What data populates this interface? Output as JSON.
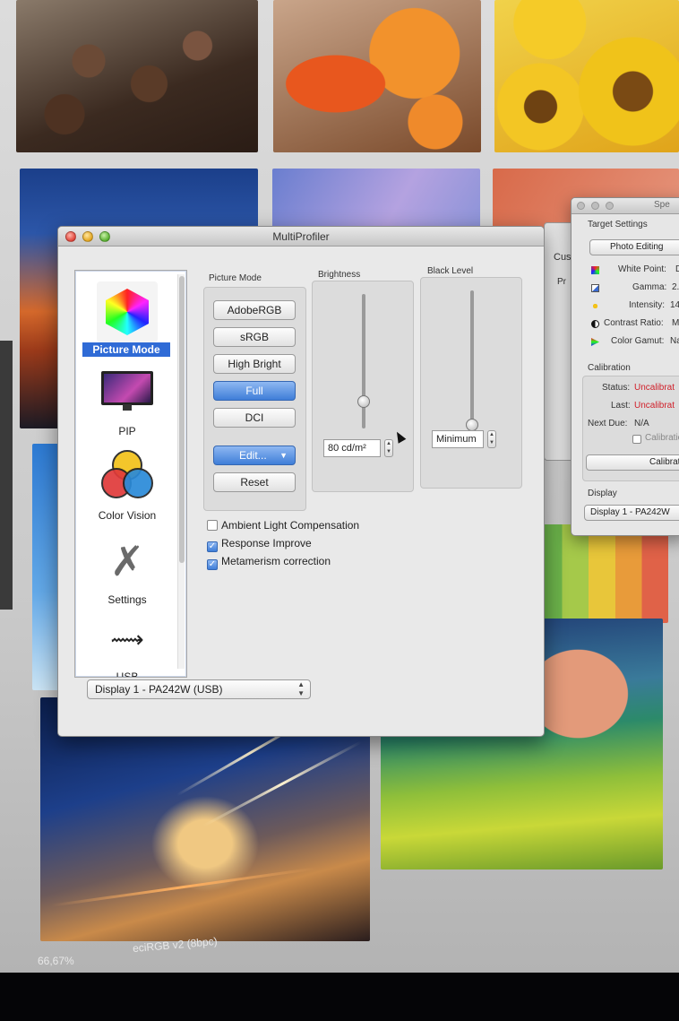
{
  "multiprofiler": {
    "title": "MultiProfiler",
    "sidebar": {
      "items": [
        {
          "label": "Picture Mode",
          "icon": "color-hexagon-icon",
          "active": true
        },
        {
          "label": "PIP",
          "icon": "monitor-icon",
          "active": false
        },
        {
          "label": "Color Vision",
          "icon": "color-vision-icon",
          "active": false
        },
        {
          "label": "Settings",
          "icon": "tools-icon",
          "active": false
        },
        {
          "label": "USB",
          "icon": "usb-icon",
          "active": false
        }
      ]
    },
    "picture_mode": {
      "label": "Picture Mode",
      "buttons": [
        "AdobeRGB",
        "sRGB",
        "High Bright",
        "Full",
        "DCI"
      ],
      "selected": "Full",
      "edit_label": "Edit...",
      "reset_label": "Reset"
    },
    "brightness": {
      "label": "Brightness",
      "value": "80 cd/m²",
      "level": 0.2
    },
    "black_level": {
      "label": "Black Level",
      "value": "Minimum",
      "level": 0.0
    },
    "options": [
      {
        "label": "Ambient Light Compensation",
        "checked": false
      },
      {
        "label": "Response Improve",
        "checked": true
      },
      {
        "label": "Metamerism correction",
        "checked": true
      }
    ],
    "display_select": "Display 1 - PA242W (USB)"
  },
  "custom_window": {
    "label": "Custo",
    "sub": "Pr"
  },
  "target_window": {
    "title": "Spe",
    "heading": "Target Settings",
    "preset": "Photo Editing",
    "rows": [
      {
        "label": "White Point:",
        "value": "D",
        "icon": "white-point-icon"
      },
      {
        "label": "Gamma:",
        "value": "2.",
        "icon": "gamma-icon"
      },
      {
        "label": "Intensity:",
        "value": "14",
        "icon": "intensity-icon"
      },
      {
        "label": "Contrast Ratio:",
        "value": "M",
        "icon": "contrast-icon"
      },
      {
        "label": "Color Gamut:",
        "value": "Na",
        "icon": "gamut-icon"
      }
    ],
    "calibration": {
      "heading": "Calibration",
      "status_label": "Status:",
      "status_value": "Uncalibrat",
      "last_label": "Last:",
      "last_value": "Uncalibrat",
      "next_label": "Next Due:",
      "next_value": "N/A",
      "check_label": "Calibratio",
      "button_label": "Calibrat"
    },
    "display_heading": "Display",
    "display_select": "Display 1 - PA242W"
  },
  "editor_status": {
    "zoom": "66,67%",
    "profile": "eciRGB v2 (8bpc)"
  },
  "colors": {
    "accent": "#3f7ed8",
    "sidebar_highlight": "#2f6bd6",
    "warning": "#d0202a"
  }
}
